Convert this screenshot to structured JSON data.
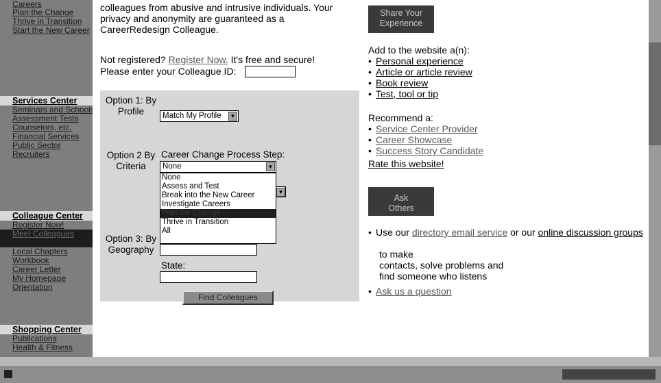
{
  "sidebar": {
    "group1": [
      "Careers",
      "Plan the Change",
      "Thrive in Transition",
      "Start the New Career"
    ],
    "services_header": "Services Center",
    "services_items": [
      "Seminars and Schools",
      "Assessment Tests",
      "Counselors, etc.",
      "Financial Services",
      "Public Sector",
      "Recruiters"
    ],
    "colleague_header": "Colleague Center",
    "colleague_items": [
      "Register Now!",
      "Meet Colleagues",
      "Local Chapters",
      "Workbook",
      "Career Letter",
      "My Homepage",
      "Orientation"
    ],
    "shopping_header": "Shopping Center",
    "shopping_items": [
      "Publications",
      "Health & Fitness"
    ]
  },
  "intro": {
    "line1": "colleagues from abusive and intrusive individuals. Your",
    "line2": "privacy and anonymity are guaranteed as a",
    "line3": "CareerRedesign Colleague.",
    "not_registered": "Not registered?",
    "register_link": "Register Now.",
    "free_secure": "It's free and secure!",
    "enter_id": "Please enter your Colleague ID:"
  },
  "form": {
    "option1": "Option 1: By Profile",
    "option1_select": "Match My Profile",
    "option2": "Option 2 By Criteria",
    "criteria_label": "Career Change Process Step:",
    "criteria_selected": "None",
    "criteria_options": [
      "None",
      "Assess and Test",
      "Break into the New Career",
      "Investigate Careers",
      "Plan the Change",
      "Thrive in Transition",
      "All"
    ],
    "option3": "Option 3: By Geography",
    "state_label": "State:",
    "find_button": "Find Colleagues"
  },
  "right": {
    "share_btn": "Share Your Experience",
    "add_title": "Add to the website a(n):",
    "add_items": [
      "Personal experience",
      "Article or article review",
      "Book review",
      "Test, tool or tip"
    ],
    "recommend_title": "Recommend a:",
    "recommend_items": [
      "Service Center Provider",
      "Career Showcase",
      "Success Story Candidate"
    ],
    "rate": "Rate this website!",
    "ask_btn": "Ask Others",
    "use_our": "Use our",
    "directory_link": "directory email service",
    "or_our": "or our",
    "online_link": "online discussion groups",
    "rest1": "to make",
    "rest2": "contacts, solve problems and",
    "rest3": "find someone who listens",
    "ask_question": "Ask us a question"
  }
}
